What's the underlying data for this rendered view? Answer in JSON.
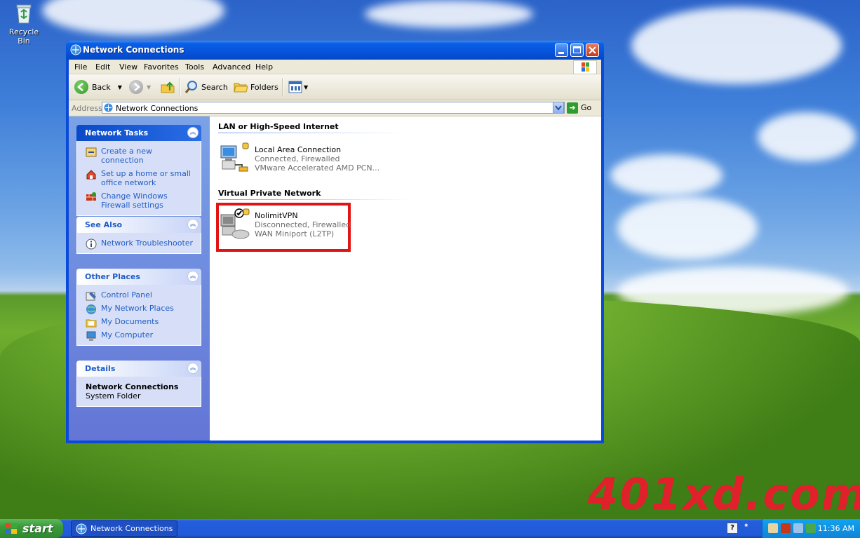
{
  "desktop": {
    "recycle_bin_label": "Recycle Bin",
    "watermark": "401xd.com"
  },
  "window": {
    "title": "Network Connections",
    "menu": [
      "File",
      "Edit",
      "View",
      "Favorites",
      "Tools",
      "Advanced",
      "Help"
    ],
    "toolbar": {
      "back_label": "Back",
      "search_label": "Search",
      "folders_label": "Folders"
    },
    "address": {
      "label": "Address",
      "value": "Network Connections",
      "go_label": "Go"
    }
  },
  "left_pane": {
    "network_tasks": {
      "title": "Network Tasks",
      "links": [
        "Create a new connection",
        "Set up a home or small office network",
        "Change Windows Firewall settings"
      ]
    },
    "see_also": {
      "title": "See Also",
      "links": [
        "Network Troubleshooter"
      ]
    },
    "other_places": {
      "title": "Other Places",
      "links": [
        "Control Panel",
        "My Network Places",
        "My Documents",
        "My Computer"
      ]
    },
    "details": {
      "title": "Details",
      "name": "Network Connections",
      "type": "System Folder"
    }
  },
  "right_pane": {
    "groups": [
      {
        "title": "LAN or High-Speed Internet",
        "connections": [
          {
            "name": "Local Area Connection",
            "status": "Connected, Firewalled",
            "device": "VMware Accelerated AMD PCN..."
          }
        ]
      },
      {
        "title": "Virtual Private Network",
        "connections": [
          {
            "name": "NolimitVPN",
            "status": "Disconnected, Firewalled",
            "device": "WAN Miniport (L2TP)"
          }
        ]
      }
    ]
  },
  "taskbar": {
    "start_label": "start",
    "task_button": "Network Connections",
    "clock": "11:36 AM"
  },
  "colors": {
    "xp_blue": "#0a4ad8",
    "link_blue": "#215dc6",
    "highlight_red": "#e01414",
    "start_green": "#3a9a3a"
  }
}
